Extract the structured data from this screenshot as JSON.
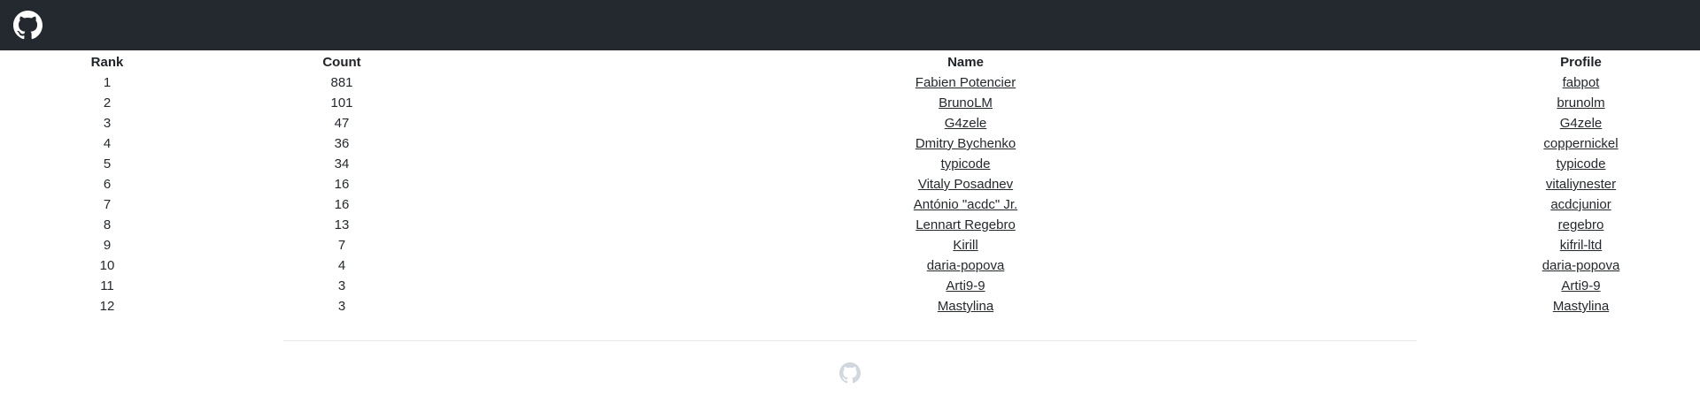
{
  "header": {
    "logo_icon": "github-mark-icon",
    "background": "#24292f"
  },
  "table": {
    "columns": [
      "Rank",
      "Count",
      "Name",
      "Profile"
    ],
    "rows": [
      {
        "rank": "1",
        "count": "881",
        "name": "Fabien Potencier",
        "profile": "fabpot"
      },
      {
        "rank": "2",
        "count": "101",
        "name": "BrunoLM",
        "profile": "brunolm"
      },
      {
        "rank": "3",
        "count": "47",
        "name": "G4zele",
        "profile": "G4zele"
      },
      {
        "rank": "4",
        "count": "36",
        "name": "Dmitry Bychenko",
        "profile": "coppernickel"
      },
      {
        "rank": "5",
        "count": "34",
        "name": "typicode",
        "profile": "typicode"
      },
      {
        "rank": "6",
        "count": "16",
        "name": "Vitaly Posadnev",
        "profile": "vitaliynester"
      },
      {
        "rank": "7",
        "count": "16",
        "name": "António \"acdc\" Jr.",
        "profile": "acdcjunior"
      },
      {
        "rank": "8",
        "count": "13",
        "name": "Lennart Regebro",
        "profile": "regebro"
      },
      {
        "rank": "9",
        "count": "7",
        "name": "Kirill",
        "profile": "kifril-ltd"
      },
      {
        "rank": "10",
        "count": "4",
        "name": "daria-popova",
        "profile": "daria-popova"
      },
      {
        "rank": "11",
        "count": "3",
        "name": "Arti9-9",
        "profile": "Arti9-9"
      },
      {
        "rank": "12",
        "count": "3",
        "name": "Mastylina",
        "profile": "Mastylina"
      }
    ]
  },
  "footer": {
    "logo_icon": "github-mark-icon"
  }
}
